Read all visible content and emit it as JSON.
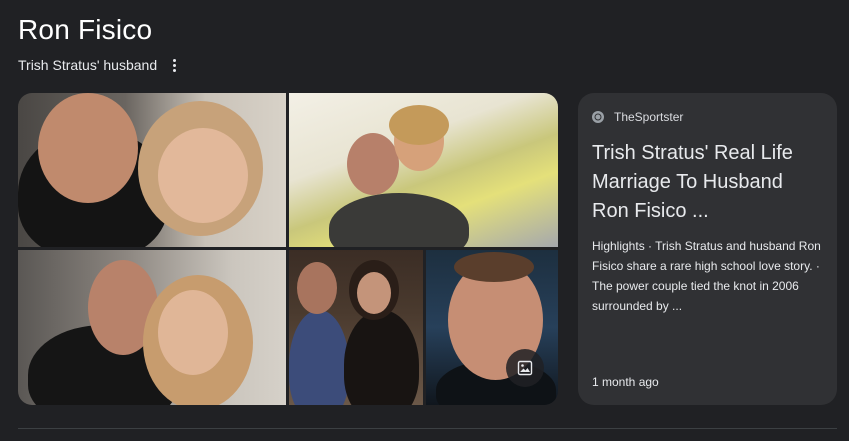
{
  "entity": {
    "title": "Ron Fisico",
    "subtitle": "Trish Stratus' husband"
  },
  "images": {
    "more_images_icon": "image-icon"
  },
  "result_card": {
    "source": "TheSportster",
    "title": "Trish Stratus' Real Life Marriage To Husband Ron Fisico ...",
    "snippet": "Highlights · Trish Stratus and husband Ron Fisico share a rare high school love story. · The power couple tied the knot in 2006 surrounded by ...",
    "date": "1 month ago"
  },
  "colors": {
    "background": "#202124",
    "card": "#303134",
    "text": "#e8eaed"
  }
}
